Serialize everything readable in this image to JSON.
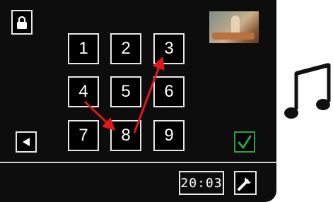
{
  "keypad": {
    "keys": [
      "1",
      "2",
      "3",
      "4",
      "5",
      "6",
      "7",
      "8",
      "9"
    ]
  },
  "status": {
    "time": "20:03"
  },
  "colors": {
    "arrow": "#e01818",
    "confirm": "#2ea043"
  },
  "icons": {
    "lock": "lock-icon",
    "back": "left-arrow-icon",
    "confirm": "check-icon",
    "settings": "wrench-icon",
    "music": "music-note-icon"
  }
}
